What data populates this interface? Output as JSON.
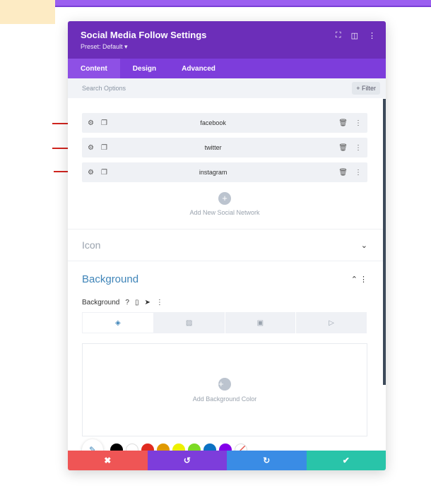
{
  "header": {
    "title": "Social Media Follow Settings",
    "preset": "Preset: Default ▾"
  },
  "header_icons": [
    "expand-icon",
    "columns-icon",
    "more-icon"
  ],
  "tabs": [
    {
      "label": "Content",
      "active": true
    },
    {
      "label": "Design",
      "active": false
    },
    {
      "label": "Advanced",
      "active": false
    }
  ],
  "search": {
    "placeholder": "Search Options",
    "filter_label": "+ Filter"
  },
  "networks": [
    {
      "label": "facebook"
    },
    {
      "label": "twitter"
    },
    {
      "label": "instagram"
    }
  ],
  "add_network_label": "Add New Social Network",
  "sections": {
    "icon_title": "Icon",
    "background_title": "Background"
  },
  "background": {
    "label": "Background",
    "help": "?",
    "add_color_label": "Add Background Color"
  },
  "swatch_colors": [
    "#000000",
    "#ffffff",
    "#e02b20",
    "#e09900",
    "#edf000",
    "#7cda24",
    "#0c71c3",
    "#8300e9"
  ],
  "footer": {
    "cancel": "✖",
    "undo": "↺",
    "redo": "↻",
    "save": "✔"
  },
  "colors": {
    "header": "#6c2eb9",
    "tabs": "#7d3ddb",
    "cancel": "#ef5555",
    "undo": "#7d3ddb",
    "redo": "#3a8ce5",
    "save": "#29c4a9"
  }
}
